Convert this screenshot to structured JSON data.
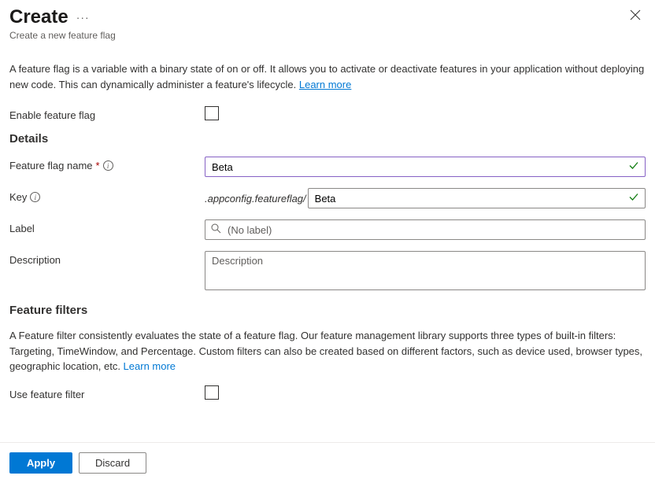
{
  "header": {
    "title": "Create",
    "subtitle": "Create a new feature flag"
  },
  "intro": {
    "text": "A feature flag is a variable with a binary state of on or off. It allows you to activate or deactivate features in your application without deploying new code. This can dynamically administer a feature's lifecycle. ",
    "link": "Learn more"
  },
  "fields": {
    "enable": {
      "label": "Enable feature flag"
    },
    "details_heading": "Details",
    "name": {
      "label": "Feature flag name",
      "value": "Beta"
    },
    "key": {
      "label": "Key",
      "prefix": ".appconfig.featureflag/",
      "value": "Beta"
    },
    "label_field": {
      "label": "Label",
      "placeholder": "(No label)"
    },
    "description": {
      "label": "Description",
      "placeholder": "Description"
    }
  },
  "filters": {
    "heading": "Feature filters",
    "text": "A Feature filter consistently evaluates the state of a feature flag. Our feature management library supports three types of built-in filters: Targeting, TimeWindow, and Percentage. Custom filters can also be created based on different factors, such as device used, browser types, geographic location, etc. ",
    "link": "Learn more",
    "use": {
      "label": "Use feature filter"
    }
  },
  "footer": {
    "apply": "Apply",
    "discard": "Discard"
  }
}
